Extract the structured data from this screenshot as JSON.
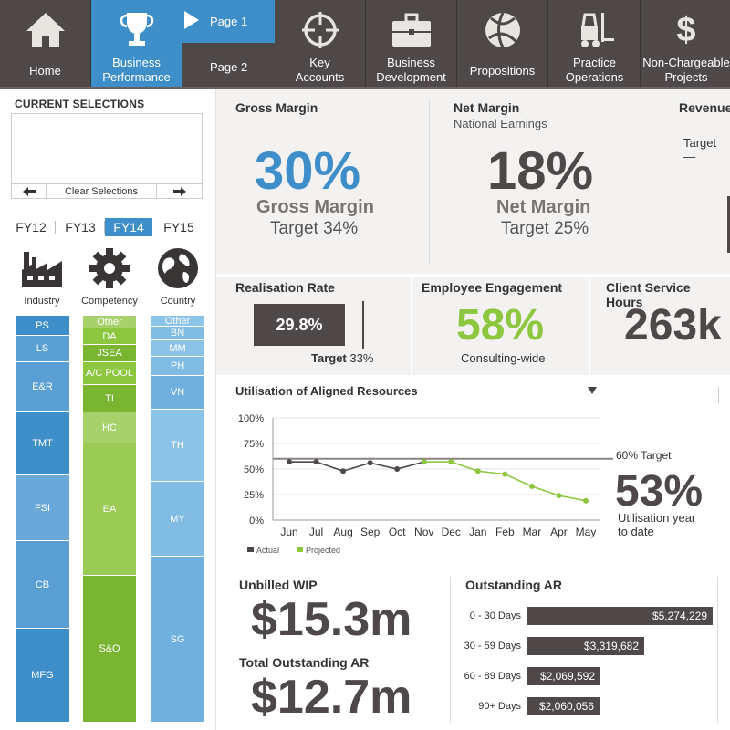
{
  "nav": {
    "home": "Home",
    "business_performance": [
      "Business",
      "Performance"
    ],
    "page1": "Page 1",
    "page2": "Page 2",
    "key_accounts": [
      "Key",
      "Accounts"
    ],
    "business_development": [
      "Business",
      "Development"
    ],
    "propositions": "Propositions",
    "practice_operations": [
      "Practice",
      "Operations"
    ],
    "non_chargeable": [
      "Non-Chargeable",
      "Projects"
    ]
  },
  "current_selections": {
    "title": "CURRENT SELECTIONS",
    "clear_label": "Clear Selections"
  },
  "fiscal_years": [
    "FY12",
    "FY13",
    "FY14",
    "FY15"
  ],
  "fiscal_year_selected": "FY14",
  "categories": {
    "industry": "Industry",
    "competency": "Competency",
    "country": "Country"
  },
  "industry_segments": [
    "PS",
    "LS",
    "E&R",
    "TMT",
    "FSI",
    "CB",
    "MFG"
  ],
  "competency_segments": [
    "Other",
    "DA",
    "JSEA",
    "A/C POOL",
    "TI",
    "HC",
    "EA",
    "S&O"
  ],
  "country_segments": [
    "Other",
    "BN",
    "MM",
    "PH",
    "VN",
    "TH",
    "MY",
    "SG"
  ],
  "gross_margin": {
    "title": "Gross Margin",
    "value": "30%",
    "label": "Gross Margin",
    "target": "Target 34%"
  },
  "net_margin": {
    "title": "Net Margin",
    "subtitle": "National Earnings",
    "value": "18%",
    "label": "Net Margin",
    "target": "Target 25%"
  },
  "revenue": {
    "title": "Revenue",
    "target": "Target —"
  },
  "realisation": {
    "title": "Realisation Rate",
    "value": "29.8%",
    "target_label": "Target",
    "target_value": "33%"
  },
  "engagement": {
    "title": "Employee Engagement",
    "value": "58%",
    "sub": "Consulting-wide"
  },
  "client_hours": {
    "title": "Client Service Hours",
    "value": "263k"
  },
  "utilisation": {
    "title": "Utilisation of Aligned Resources",
    "target_label": "60% Target",
    "value": "53%",
    "value_label": [
      "Utilisation year",
      "to date"
    ],
    "legend_actual": "Actual",
    "legend_projected": "Projected"
  },
  "chart_data": {
    "type": "line",
    "categories": [
      "Jun",
      "Jul",
      "Aug",
      "Sep",
      "Oct",
      "Nov",
      "Dec",
      "Jan",
      "Feb",
      "Mar",
      "Apr",
      "May"
    ],
    "series": [
      {
        "name": "Actual",
        "values": [
          57,
          57,
          48,
          56,
          50,
          57,
          null,
          null,
          null,
          null,
          null,
          null
        ],
        "color": "#4e4848"
      },
      {
        "name": "Projected",
        "values": [
          null,
          null,
          null,
          null,
          null,
          57,
          57,
          48,
          45,
          33,
          24,
          19
        ],
        "color": "#8dc63f"
      }
    ],
    "target": 60,
    "ylim": [
      0,
      100
    ],
    "yticks": [
      "0%",
      "25%",
      "50%",
      "75%",
      "100%"
    ],
    "title": "Utilisation of Aligned Resources",
    "legend": "bottom-left"
  },
  "wip": {
    "unbilled_title": "Unbilled WIP",
    "unbilled_value": "$15.3m",
    "total_title": "Total Outstanding AR",
    "total_value": "$12.7m"
  },
  "outstanding_ar": {
    "title": "Outstanding AR",
    "rows": [
      {
        "label": "0 - 30 Days",
        "value": "$5,274,229",
        "amount": 5274229
      },
      {
        "label": "30 - 59 Days",
        "value": "$3,319,682",
        "amount": 3319682
      },
      {
        "label": "60 - 89 Days",
        "value": "$2,069,592",
        "amount": 2069592
      },
      {
        "label": "90+ Days",
        "value": "$2,060,056",
        "amount": 2060056
      }
    ]
  },
  "colors": {
    "blue": "#3e8ec9",
    "green": "#8dc63f",
    "dark": "#4e4848",
    "gray_text": "#555555"
  }
}
